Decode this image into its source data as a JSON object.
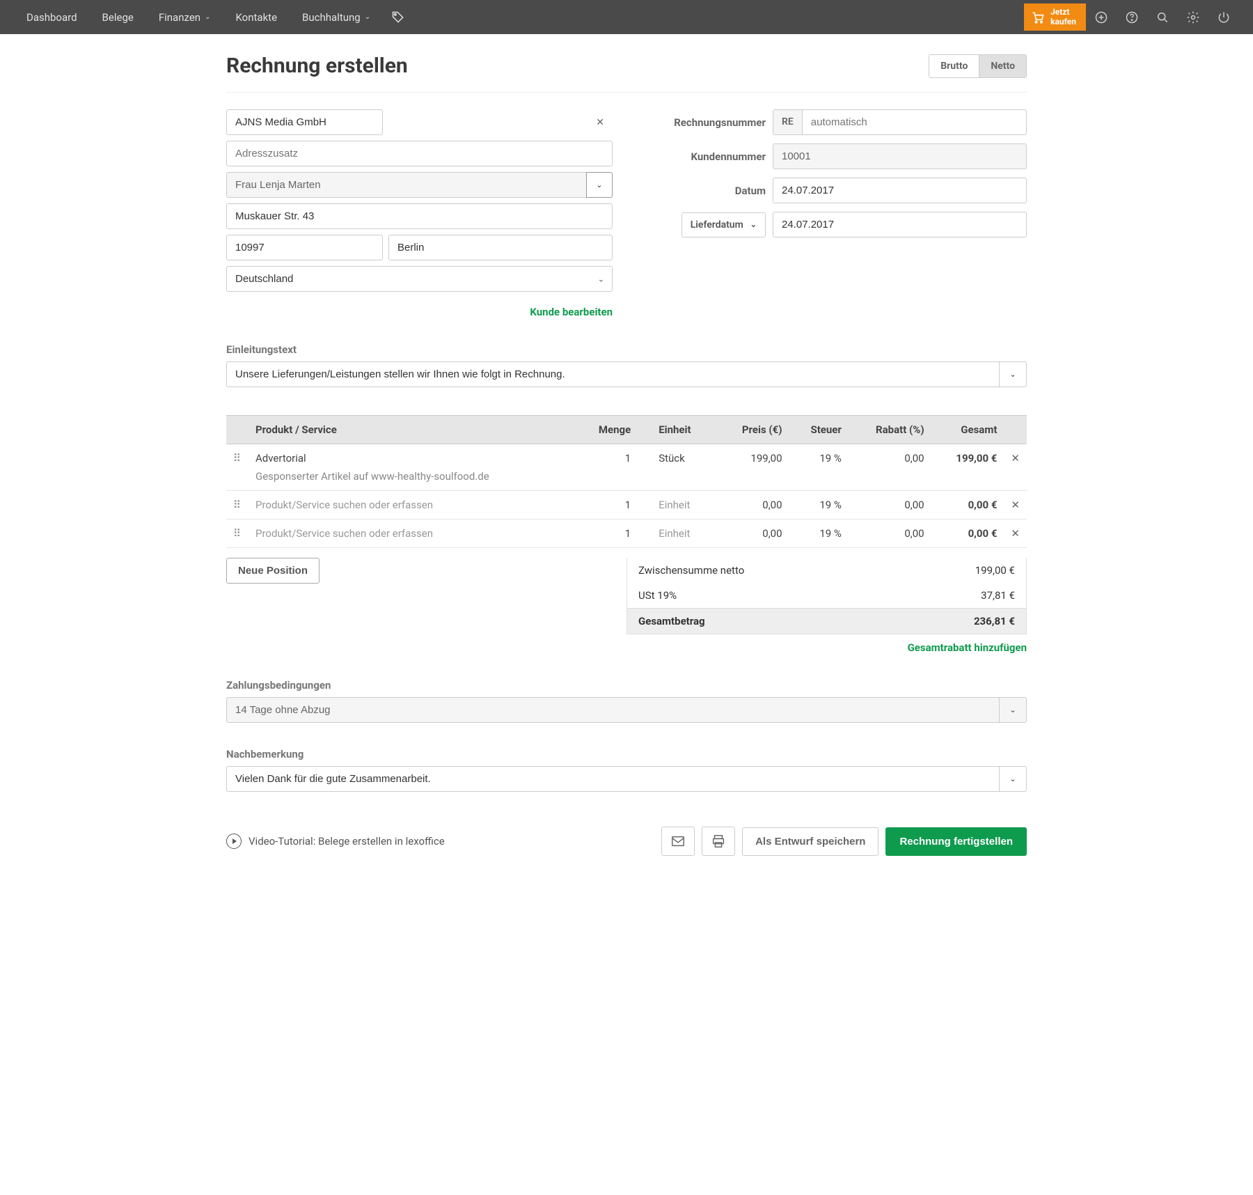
{
  "nav": {
    "items": [
      "Dashboard",
      "Belege",
      "Finanzen",
      "Kontakte",
      "Buchhaltung"
    ],
    "buy_now": "Jetzt\nkaufen"
  },
  "header": {
    "title": "Rechnung erstellen",
    "toggle": {
      "brutto": "Brutto",
      "netto": "Netto"
    }
  },
  "customer": {
    "company": "AJNS Media GmbH",
    "addr2_ph": "Adresszusatz",
    "contact": "Frau Lenja Marten",
    "street": "Muskauer Str. 43",
    "zip": "10997",
    "city": "Berlin",
    "country": "Deutschland",
    "edit_link": "Kunde bearbeiten"
  },
  "invoice": {
    "num_label": "Rechnungsnummer",
    "num_prefix": "RE",
    "num_ph": "automatisch",
    "custnum_label": "Kundennummer",
    "custnum": "10001",
    "date_label": "Datum",
    "date": "24.07.2017",
    "delivdate_label": "Lieferdatum",
    "delivdate": "24.07.2017"
  },
  "intro": {
    "label": "Einleitungstext",
    "text": "Unsere Lieferungen/Leistungen stellen wir Ihnen wie folgt in Rechnung."
  },
  "table": {
    "headers": {
      "product": "Produkt / Service",
      "qty": "Menge",
      "unit": "Einheit",
      "price": "Preis (€)",
      "tax": "Steuer",
      "discount": "Rabatt (%)",
      "total": "Gesamt"
    },
    "rows": [
      {
        "product": "Advertorial",
        "desc": "Gesponserter Artikel auf www-healthy-soulfood.de",
        "qty": "1",
        "unit": "Stück",
        "price": "199,00",
        "tax": "19 %",
        "discount": "0,00",
        "total": "199,00 €",
        "placeholder": false
      },
      {
        "product": "Produkt/Service suchen oder erfassen",
        "desc": "",
        "qty": "1",
        "unit": "Einheit",
        "price": "0,00",
        "tax": "19 %",
        "discount": "0,00",
        "total": "0,00 €",
        "placeholder": true
      },
      {
        "product": "Produkt/Service suchen oder erfassen",
        "desc": "",
        "qty": "1",
        "unit": "Einheit",
        "price": "0,00",
        "tax": "19 %",
        "discount": "0,00",
        "total": "0,00 €",
        "placeholder": true
      }
    ],
    "new_position": "Neue Position"
  },
  "totals": {
    "rows": [
      {
        "label": "Zwischensumme netto",
        "value": "199,00 €"
      },
      {
        "label": "USt 19%",
        "value": "37,81 €"
      },
      {
        "label": "Gesamtbetrag",
        "value": "236,81 €",
        "bold": true
      }
    ],
    "discount_link": "Gesamtrabatt hinzufügen"
  },
  "payment": {
    "label": "Zahlungsbedingungen",
    "value": "14 Tage ohne Abzug"
  },
  "remarks": {
    "label": "Nachbemerkung",
    "value": "Vielen Dank für die gute Zusammenarbeit."
  },
  "footer": {
    "tutorial": "Video-Tutorial: Belege erstellen in lexoffice",
    "save_draft": "Als Entwurf speichern",
    "finalize": "Rechnung fertigstellen"
  }
}
